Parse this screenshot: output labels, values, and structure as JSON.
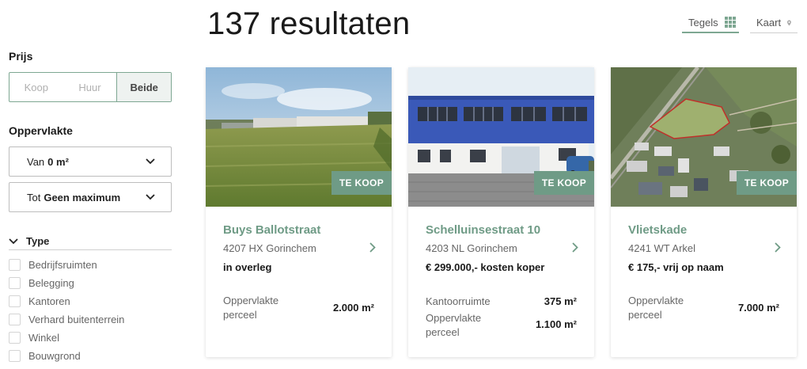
{
  "header": {
    "results_title": "137 resultaten",
    "view_tiles_label": "Tegels",
    "view_map_label": "Kaart"
  },
  "filters": {
    "price": {
      "label": "Prijs",
      "options": [
        "Koop",
        "Huur",
        "Beide"
      ],
      "selected": "Beide"
    },
    "area": {
      "label": "Oppervlakte",
      "from_prefix": "Van",
      "from_value": "0 m²",
      "to_prefix": "Tot",
      "to_value": "Geen maximum"
    },
    "type": {
      "label": "Type",
      "options": [
        "Bedrijfsruimten",
        "Belegging",
        "Kantoren",
        "Verhard buitenterrein",
        "Winkel",
        "Bouwgrond"
      ]
    }
  },
  "listings": [
    {
      "badge": "TE KOOP",
      "title": "Buys Ballotstraat",
      "address": "4207 HX Gorinchem",
      "price": "in overleg",
      "specs": [
        {
          "label": "Oppervlakte perceel",
          "value": "2.000 m²"
        }
      ]
    },
    {
      "badge": "TE KOOP",
      "title": "Schelluinsestraat 10",
      "address": "4203 NL Gorinchem",
      "price": "€ 299.000,- kosten koper",
      "specs": [
        {
          "label": "Kantoorruimte",
          "value": "375 m²"
        },
        {
          "label": "Oppervlakte perceel",
          "value": "1.100 m²"
        }
      ]
    },
    {
      "badge": "TE KOOP",
      "title": "Vlietskade",
      "address": "4241 WT Arkel",
      "price": "€ 175,- vrij op naam",
      "specs": [
        {
          "label": "Oppervlakte perceel",
          "value": "7.000 m²"
        }
      ]
    }
  ],
  "colors": {
    "accent": "#6f9b86",
    "accent_light": "#7ea792",
    "text_dark": "#1a1a1a",
    "text_muted": "#666666"
  }
}
